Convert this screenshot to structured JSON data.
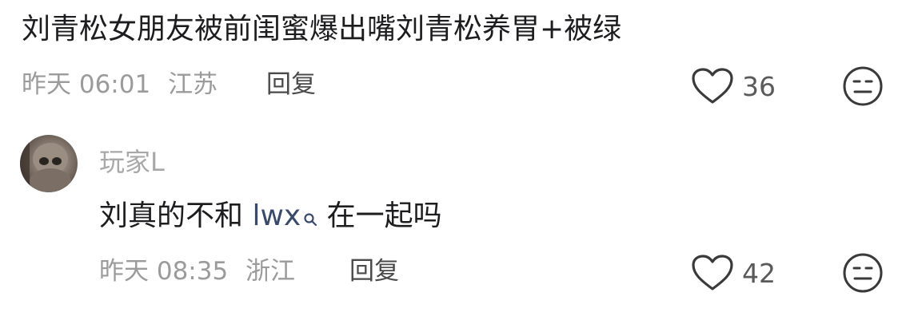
{
  "comment": {
    "text": "刘青松女朋友被前闺蜜爆出嘴刘青松养胃+被绿",
    "time": "昨天 06:01",
    "location": "江苏",
    "reply_label": "回复",
    "likes": "36"
  },
  "reply": {
    "username": "玩家L",
    "text_before": "刘真的不和 ",
    "link_text": "lwx",
    "text_after": " 在一起吗",
    "time": "昨天 08:35",
    "location": "浙江",
    "reply_label": "回复",
    "likes": "42"
  },
  "icons": {
    "like": "heart-outline-icon",
    "reaction": "neutral-face-icon",
    "search": "search-icon"
  }
}
